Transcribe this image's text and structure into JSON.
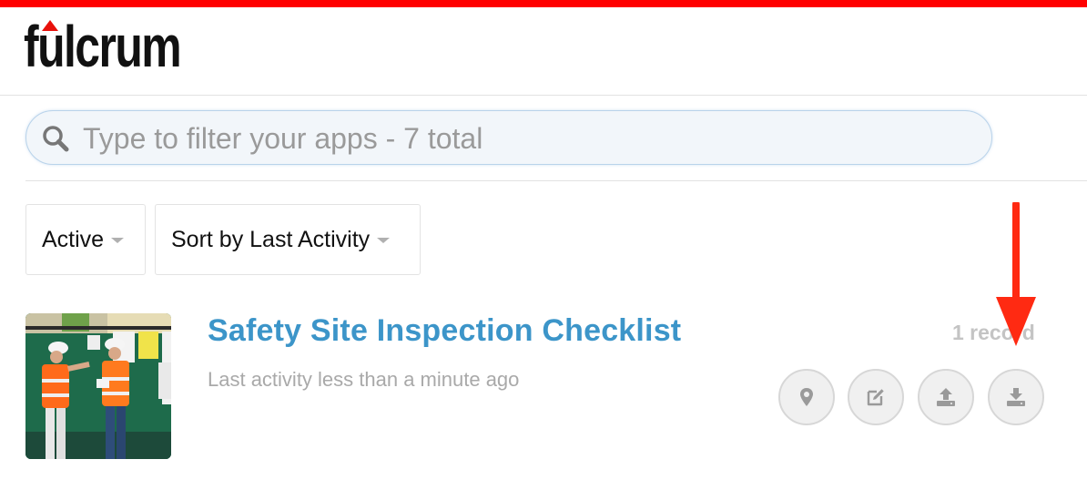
{
  "brand": {
    "logo_text": "fulcrum",
    "accent_color": "#e8110b",
    "top_bar_color": "#ff0000"
  },
  "search": {
    "placeholder": "Type to filter your apps - 7 total",
    "value": "",
    "icon": "search-icon"
  },
  "filters": {
    "status": {
      "selected": "Active",
      "icon": "caret-down-icon"
    },
    "sort": {
      "selected": "Sort by Last Activity",
      "icon": "caret-down-icon"
    }
  },
  "apps": [
    {
      "title": "Safety Site Inspection Checklist",
      "last_activity": "Last activity less than a minute ago",
      "record_count": "1 record",
      "title_color": "#3c95c9",
      "thumbnail": "safety-inspectors-photo",
      "actions": [
        {
          "icon": "map-pin-icon",
          "label": "Map"
        },
        {
          "icon": "edit-icon",
          "label": "Edit"
        },
        {
          "icon": "upload-icon",
          "label": "Import"
        },
        {
          "icon": "download-icon",
          "label": "Export"
        }
      ]
    }
  ],
  "annotation": {
    "icon": "red-arrow-icon",
    "color": "#ff2a12",
    "points_to": "download-icon"
  }
}
